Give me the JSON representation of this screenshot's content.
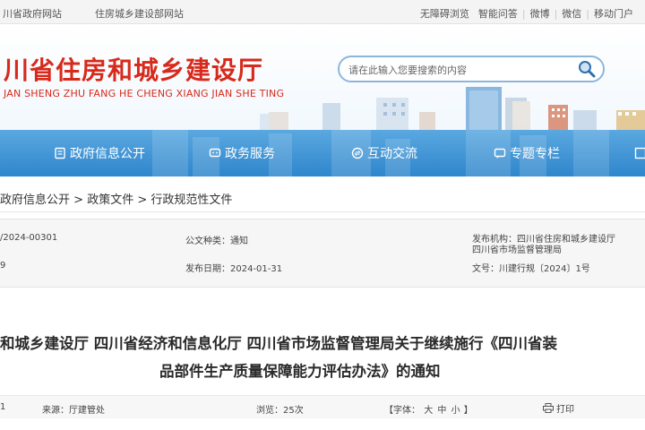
{
  "topbar": {
    "left_links": [
      "川省政府网站",
      "住房城乡建设部网站"
    ],
    "right_links": [
      "无障碍浏览",
      "智能问答",
      "微博",
      "微信",
      "移动门户"
    ]
  },
  "header": {
    "title": "川省住房和城乡建设厅",
    "subtitle": "JAN SHENG ZHU FANG HE CHENG XIANG JIAN SHE TING",
    "search_placeholder": "请在此输入您要搜索的内容"
  },
  "nav": {
    "items": [
      {
        "label": "政府信息公开",
        "icon": "document-icon"
      },
      {
        "label": "政务服务",
        "icon": "chat-icon"
      },
      {
        "label": "互动交流",
        "icon": "exchange-icon"
      },
      {
        "label": "专题专栏",
        "icon": "message-icon"
      }
    ]
  },
  "breadcrumb": {
    "items": [
      "政府信息公开",
      "政策文件",
      "行政规范性文件"
    ],
    "separator": " > "
  },
  "info": {
    "index_no": "/2024-00301",
    "doc_type": "公文种类：通知",
    "issuer_label": "发布机构：四川省住房和城乡建设厅",
    "issuer_extra": "四川省市场监督管理局",
    "written_date": "9",
    "publish_date": "发布日期：2024-01-31",
    "doc_number": "文号：川建行规〔2024〕1号"
  },
  "doc": {
    "title_line1": "和城乡建设厅 四川省经济和信息化厅 四川省市场监督管理局关于继续施行《四川省装",
    "title_line2": "品部件生产质量保障能力评估办法》的通知"
  },
  "meta": {
    "date_fragment": "1",
    "source": "来源：厅建管处",
    "views": "浏览：25次",
    "font_label": "【字体：",
    "font_large": "大",
    "font_medium": "中",
    "font_small": "小",
    "font_close": "】",
    "print": "打印"
  },
  "colors": {
    "brand_red": "#d72a1c",
    "nav_blue": "#3f93d6",
    "search_border": "#8cb6dc"
  }
}
